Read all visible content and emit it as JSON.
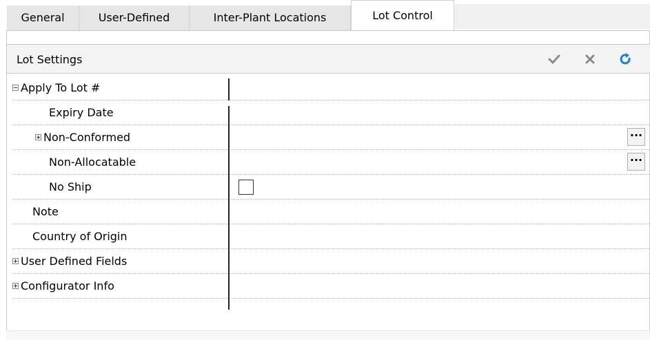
{
  "tabs": [
    {
      "label": "General"
    },
    {
      "label": "User-Defined"
    },
    {
      "label": "Inter-Plant Locations"
    },
    {
      "label": "Lot Control",
      "active": true
    }
  ],
  "panel": {
    "title": "Lot Settings",
    "actions": [
      {
        "name": "accept-button",
        "icon": "checkmark-icon",
        "color": "#8a8a8a"
      },
      {
        "name": "cancel-button",
        "icon": "close-icon",
        "color": "#8a8a8a"
      },
      {
        "name": "refresh-button",
        "icon": "refresh-icon",
        "color": "#1a7fd4"
      }
    ]
  },
  "grid": {
    "rows": [
      {
        "label": "Apply To Lot #",
        "expander": "minus"
      },
      {
        "label": "Expiry Date"
      },
      {
        "label": "Non-Conformed",
        "expander": "plus",
        "has_ellipsis": true
      },
      {
        "label": "Non-Allocatable",
        "has_ellipsis": true
      },
      {
        "label": "No Ship",
        "checkbox": false
      },
      {
        "label": "Note"
      },
      {
        "label": "Country of Origin"
      },
      {
        "label": "User Defined Fields",
        "expander": "plus"
      },
      {
        "label": "Configurator Info",
        "expander": "plus"
      }
    ],
    "ellipsis_label": "···"
  }
}
